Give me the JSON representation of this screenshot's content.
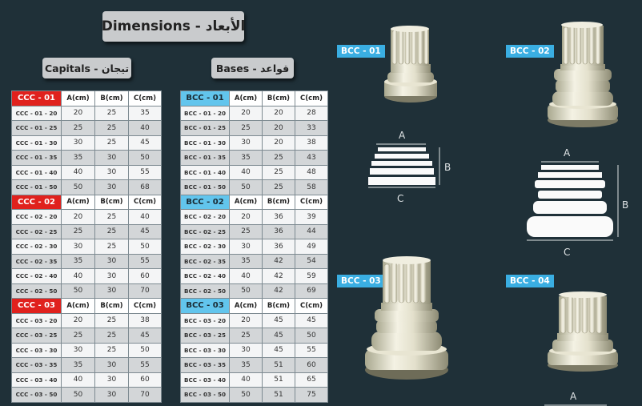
{
  "header": {
    "title": "Dimensions - الأبعاد",
    "capitals_label": "Capitals - تيجان",
    "bases_label": "Bases - قواعد"
  },
  "columns": [
    "A(cm)",
    "B(cm)",
    "C(cm)"
  ],
  "capitals": [
    {
      "code": "CCC - 01",
      "rows": [
        [
          "CCC - 01 - 20",
          "20",
          "25",
          "35"
        ],
        [
          "CCC - 01 - 25",
          "25",
          "25",
          "40"
        ],
        [
          "CCC - 01 - 30",
          "30",
          "25",
          "45"
        ],
        [
          "CCC - 01 - 35",
          "35",
          "30",
          "50"
        ],
        [
          "CCC - 01 - 40",
          "40",
          "30",
          "55"
        ],
        [
          "CCC - 01 - 50",
          "50",
          "30",
          "68"
        ]
      ]
    },
    {
      "code": "CCC - 02",
      "rows": [
        [
          "CCC - 02 - 20",
          "20",
          "25",
          "40"
        ],
        [
          "CCC - 02 - 25",
          "25",
          "25",
          "45"
        ],
        [
          "CCC - 02 - 30",
          "30",
          "25",
          "50"
        ],
        [
          "CCC - 02 - 35",
          "35",
          "30",
          "55"
        ],
        [
          "CCC - 02 - 40",
          "40",
          "30",
          "60"
        ],
        [
          "CCC - 02 - 50",
          "50",
          "30",
          "70"
        ]
      ]
    },
    {
      "code": "CCC - 03",
      "rows": [
        [
          "CCC - 03 - 20",
          "20",
          "25",
          "38"
        ],
        [
          "CCC - 03 - 25",
          "25",
          "25",
          "45"
        ],
        [
          "CCC - 03 - 30",
          "30",
          "25",
          "50"
        ],
        [
          "CCC - 03 - 35",
          "35",
          "30",
          "55"
        ],
        [
          "CCC - 03 - 40",
          "40",
          "30",
          "60"
        ],
        [
          "CCC - 03 - 50",
          "50",
          "30",
          "70"
        ]
      ]
    }
  ],
  "bases": [
    {
      "code": "BCC - 01",
      "rows": [
        [
          "BCC - 01 - 20",
          "20",
          "20",
          "28"
        ],
        [
          "BCC - 01 - 25",
          "25",
          "20",
          "33"
        ],
        [
          "BCC - 01 - 30",
          "30",
          "20",
          "38"
        ],
        [
          "BCC - 01 - 35",
          "35",
          "25",
          "43"
        ],
        [
          "BCC - 01 - 40",
          "40",
          "25",
          "48"
        ],
        [
          "BCC - 01 - 50",
          "50",
          "25",
          "58"
        ]
      ]
    },
    {
      "code": "BCC - 02",
      "rows": [
        [
          "BCC - 02 - 20",
          "20",
          "36",
          "39"
        ],
        [
          "BCC - 02 - 25",
          "25",
          "36",
          "44"
        ],
        [
          "BCC - 02 - 30",
          "30",
          "36",
          "49"
        ],
        [
          "BCC - 02 - 35",
          "35",
          "42",
          "54"
        ],
        [
          "BCC - 02 - 40",
          "40",
          "42",
          "59"
        ],
        [
          "BCC - 02 - 50",
          "50",
          "42",
          "69"
        ]
      ]
    },
    {
      "code": "BCC - 03",
      "rows": [
        [
          "BCC - 03 - 20",
          "20",
          "45",
          "45"
        ],
        [
          "BCC - 03 - 25",
          "25",
          "45",
          "50"
        ],
        [
          "BCC - 03 - 30",
          "30",
          "45",
          "55"
        ],
        [
          "BCC - 03 - 35",
          "35",
          "51",
          "60"
        ],
        [
          "BCC - 03 - 40",
          "40",
          "51",
          "65"
        ],
        [
          "BCC - 03 - 50",
          "50",
          "51",
          "75"
        ]
      ]
    }
  ],
  "products": {
    "bcc01": "BCC - 01",
    "bcc02": "BCC - 02",
    "bcc03": "BCC - 03",
    "bcc04": "BCC - 04"
  },
  "diagram_labels": {
    "a": "A",
    "b": "B",
    "c": "C"
  },
  "colors": {
    "background": "#1f3038",
    "capital_code": "#e0211d",
    "base_code": "#62c5ed",
    "product_label": "#3aaee2"
  }
}
